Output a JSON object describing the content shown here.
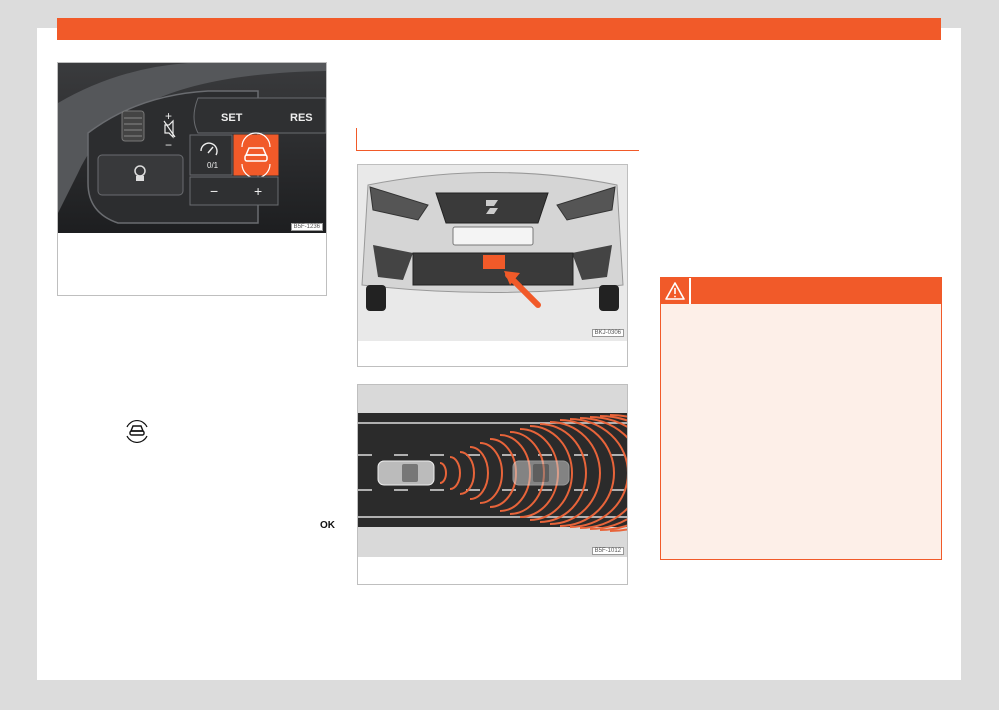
{
  "figures": {
    "steering_wheel": {
      "code": "B5F-1236",
      "labels": {
        "set": "SET",
        "res": "RES",
        "on_off": "0/1",
        "minus": "−",
        "plus": "+",
        "vol_plus": "+",
        "vol_minus": "−"
      }
    },
    "front_sensor": {
      "code": "BKJ-0306",
      "brand": "SEAT"
    },
    "radar_diagram": {
      "code": "B5F-1012"
    }
  },
  "body": {
    "ok_symbol": "OK"
  },
  "icons": {
    "warning": "warning-triangle-icon",
    "acc_button": "adaptive-cruise-icon",
    "cruise": "cruise-control-icon",
    "mute": "mute-icon"
  },
  "colors": {
    "accent": "#f15a29",
    "warning_bg": "#fdefe8"
  }
}
